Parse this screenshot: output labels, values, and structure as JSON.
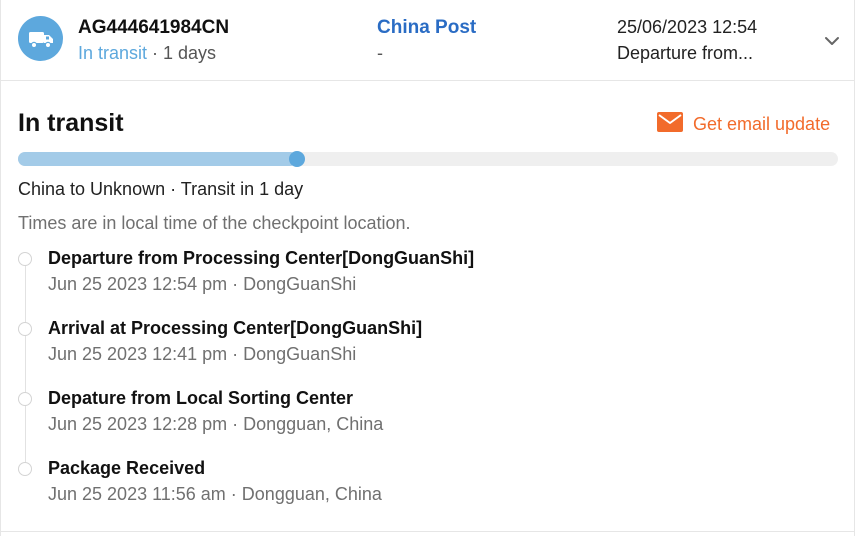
{
  "header": {
    "tracking_number": "AG444641984CN",
    "status": "In transit",
    "duration": " · 1 days",
    "carrier_name": "China Post",
    "carrier_sub": "-",
    "last_update_time": "25/06/2023 12:54",
    "last_update_event": "Departure from...",
    "icons": {
      "carrier": "truck-icon",
      "expand": "chevron-down-icon"
    },
    "colors": {
      "badge": "#5da8dd",
      "carrier_link": "#2a6cc4",
      "status": "#5da8dd"
    }
  },
  "main": {
    "title": "In transit",
    "email_update_label": "Get email update",
    "email_icon": "mail-icon",
    "email_color": "#f26b2b",
    "progress": 0.34,
    "route_info": "China to Unknown · Transit in 1 day",
    "timezone_note": "Times are in local time of the checkpoint location."
  },
  "events": [
    {
      "title": "Departure from Processing Center[DongGuanShi]",
      "meta": "Jun 25 2023 12:54 pm · DongGuanShi"
    },
    {
      "title": "Arrival at Processing Center[DongGuanShi]",
      "meta": "Jun 25 2023 12:41 pm · DongGuanShi"
    },
    {
      "title": "Depature from Local Sorting Center",
      "meta": "Jun 25 2023 12:28 pm · Dongguan, China"
    },
    {
      "title": "Package Received",
      "meta": "Jun 25 2023 11:56 am · Dongguan, China"
    }
  ]
}
